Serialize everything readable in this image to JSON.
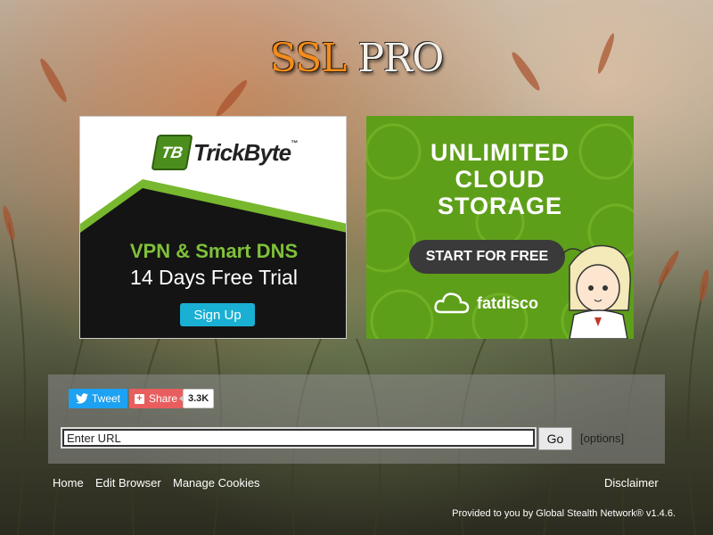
{
  "logo": {
    "ssl": "SSL",
    "pro": "PRO"
  },
  "ad_left": {
    "brand": "TrickByte",
    "brand_mark": "TB",
    "trademark": "™",
    "headline": "VPN & Smart DNS",
    "subline": "14 Days Free Trial",
    "button": "Sign Up",
    "colors": {
      "green": "#7fc13a",
      "button": "#1ab0d4"
    }
  },
  "ad_right": {
    "title_line1": "UNLIMITED",
    "title_line2": "CLOUD",
    "title_line3": "STORAGE",
    "button": "START FOR FREE",
    "brand": "fatdisco",
    "colors": {
      "background": "#5e9f1a"
    }
  },
  "social": {
    "tweet_label": "Tweet",
    "share_label": "Share",
    "share_count": "3.3K"
  },
  "url_bar": {
    "value": "Enter URL",
    "go_label": "Go",
    "options_label": "[options]"
  },
  "footer": {
    "home": "Home",
    "edit_browser": "Edit Browser",
    "manage_cookies": "Manage Cookies",
    "disclaimer": "Disclaimer",
    "provided_by": "Provided to you by Global Stealth Network® v1.4.6."
  }
}
